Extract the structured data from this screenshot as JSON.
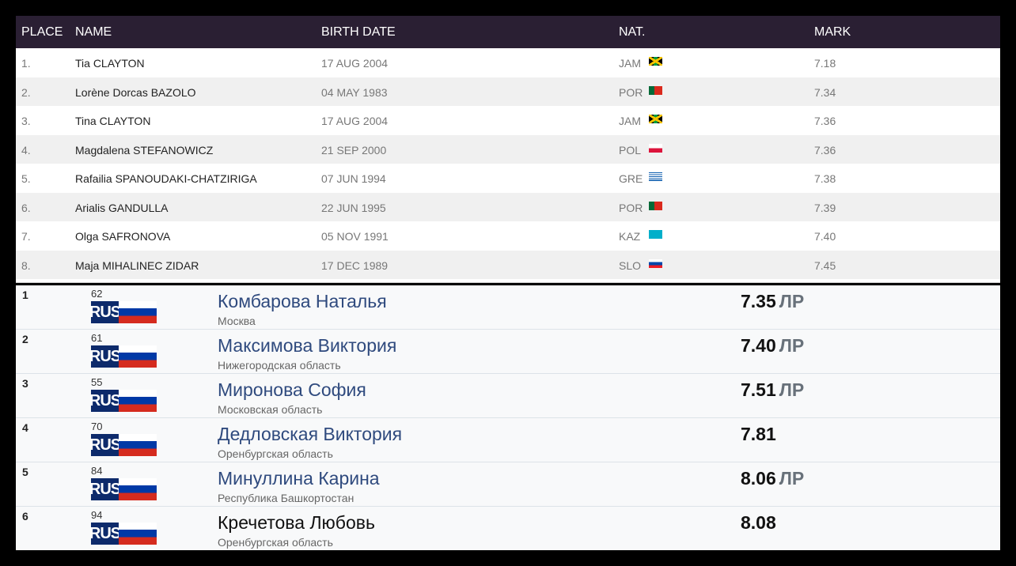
{
  "wa_table": {
    "headers": {
      "place": "PLACE",
      "name": "NAME",
      "birth": "BIRTH DATE",
      "nat": "NAT.",
      "mark": "MARK"
    },
    "rows": [
      {
        "place": "1.",
        "name": "Tia CLAYTON",
        "birth": "17 AUG 2004",
        "nat": "JAM",
        "mark": "7.18"
      },
      {
        "place": "2.",
        "name": "Lorène Dorcas BAZOLO",
        "birth": "04 MAY 1983",
        "nat": "POR",
        "mark": "7.34"
      },
      {
        "place": "3.",
        "name": "Tina CLAYTON",
        "birth": "17 AUG 2004",
        "nat": "JAM",
        "mark": "7.36"
      },
      {
        "place": "4.",
        "name": "Magdalena STEFANOWICZ",
        "birth": "21 SEP 2000",
        "nat": "POL",
        "mark": "7.36"
      },
      {
        "place": "5.",
        "name": "Rafailia SPANOUDAKI-CHATZIRIGA",
        "birth": "07 JUN 1994",
        "nat": "GRE",
        "mark": "7.38"
      },
      {
        "place": "6.",
        "name": "Arialis GANDULLA",
        "birth": "22 JUN 1995",
        "nat": "POR",
        "mark": "7.39"
      },
      {
        "place": "7.",
        "name": "Olga SAFRONOVA",
        "birth": "05 NOV 1991",
        "nat": "KAZ",
        "mark": "7.40"
      },
      {
        "place": "8.",
        "name": "Maja MIHALINEC ZIDAR",
        "birth": "17 DEC 1989",
        "nat": "SLO",
        "mark": "7.45"
      }
    ]
  },
  "ru_results": {
    "rows": [
      {
        "place": "1",
        "bib": "62",
        "country": "RUS",
        "name": "Комбарова Наталья",
        "region": "Москва",
        "mark": "7.35",
        "note": "ЛР",
        "linked": true
      },
      {
        "place": "2",
        "bib": "61",
        "country": "RUS",
        "name": "Максимова Виктория",
        "region": "Нижегородская область",
        "mark": "7.40",
        "note": "ЛР",
        "linked": true
      },
      {
        "place": "3",
        "bib": "55",
        "country": "RUS",
        "name": "Миронова София",
        "region": "Московская область",
        "mark": "7.51",
        "note": "ЛР",
        "linked": true
      },
      {
        "place": "4",
        "bib": "70",
        "country": "RUS",
        "name": "Дедловская Виктория",
        "region": "Оренбургская область",
        "mark": "7.81",
        "note": "",
        "linked": true
      },
      {
        "place": "5",
        "bib": "84",
        "country": "RUS",
        "name": "Минуллина Карина",
        "region": "Республика Башкортостан",
        "mark": "8.06",
        "note": "ЛР",
        "linked": true
      },
      {
        "place": "6",
        "bib": "94",
        "country": "RUS",
        "name": "Кречетова Любовь",
        "region": "Оренбургская область",
        "mark": "8.08",
        "note": "",
        "linked": false
      }
    ]
  }
}
